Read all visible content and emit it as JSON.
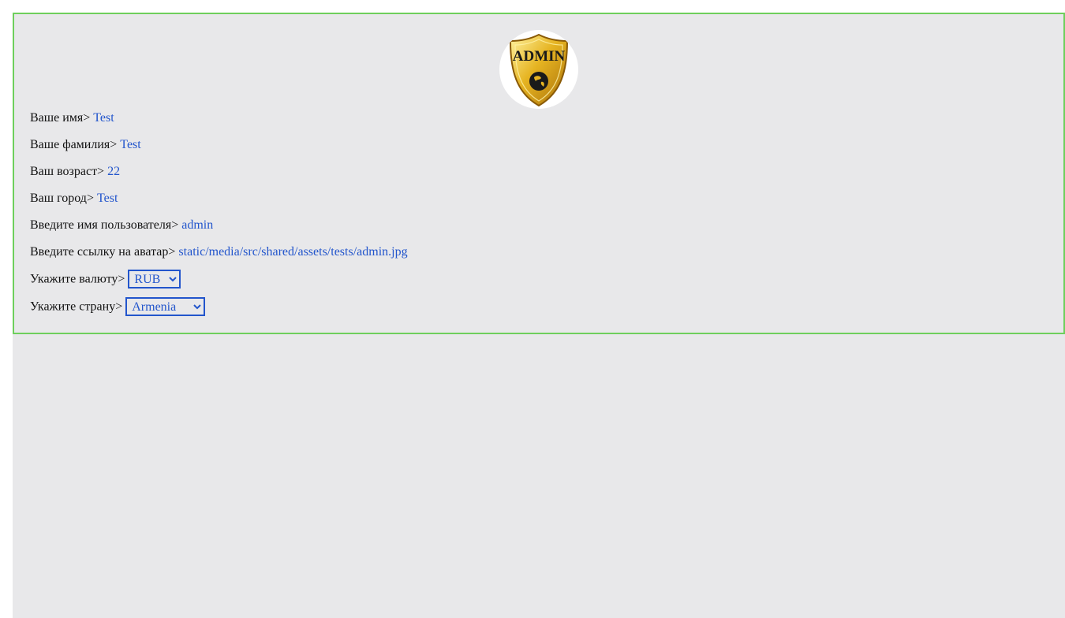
{
  "profile": {
    "avatar_icon": "admin-shield-icon",
    "avatar_text": "ADMIN",
    "fields": [
      {
        "label": "Ваше имя>",
        "value": "Test"
      },
      {
        "label": "Ваше фамилия>",
        "value": "Test"
      },
      {
        "label": "Ваш возраст>",
        "value": "22"
      },
      {
        "label": "Ваш город>",
        "value": "Test"
      },
      {
        "label": "Введите имя пользователя>",
        "value": "admin"
      },
      {
        "label": "Введите ссылку на аватар>",
        "value": "static/media/src/shared/assets/tests/admin.jpg"
      }
    ],
    "currency": {
      "label": "Укажите валюту>",
      "selected": "RUB"
    },
    "country": {
      "label": "Укажите страну>",
      "selected": "Armenia"
    }
  },
  "colors": {
    "card_border": "#6ecf5c",
    "background": "#e8e8ea",
    "value_text": "#2255cc"
  }
}
